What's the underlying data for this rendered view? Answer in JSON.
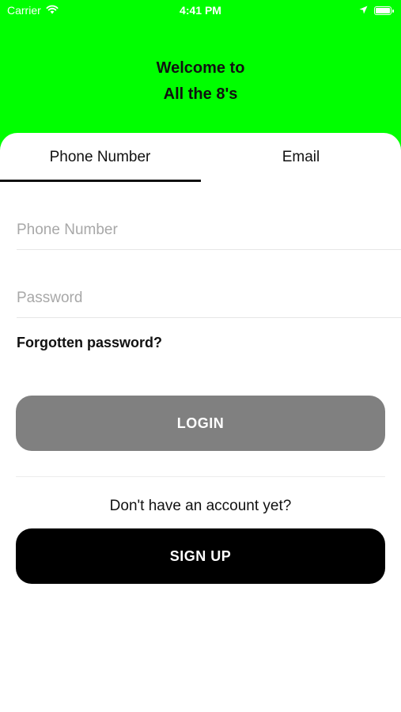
{
  "status_bar": {
    "carrier": "Carrier",
    "time": "4:41 PM",
    "icons": [
      "wifi-icon",
      "location-arrow-icon",
      "battery-icon"
    ]
  },
  "header": {
    "line1": "Welcome to",
    "line2": "All the 8's",
    "background_color": "#00ff00"
  },
  "tabs": [
    {
      "label": "Phone Number",
      "active": true
    },
    {
      "label": "Email",
      "active": false
    }
  ],
  "form": {
    "phone_placeholder": "Phone Number",
    "phone_value": "",
    "password_placeholder": "Password",
    "password_value": "",
    "forgot_label": "Forgotten password?",
    "login_label": "LOGIN",
    "login_color": "#808080"
  },
  "signup": {
    "prompt": "Don't have an account yet?",
    "button_label": "SIGN UP",
    "button_color": "#000000"
  }
}
